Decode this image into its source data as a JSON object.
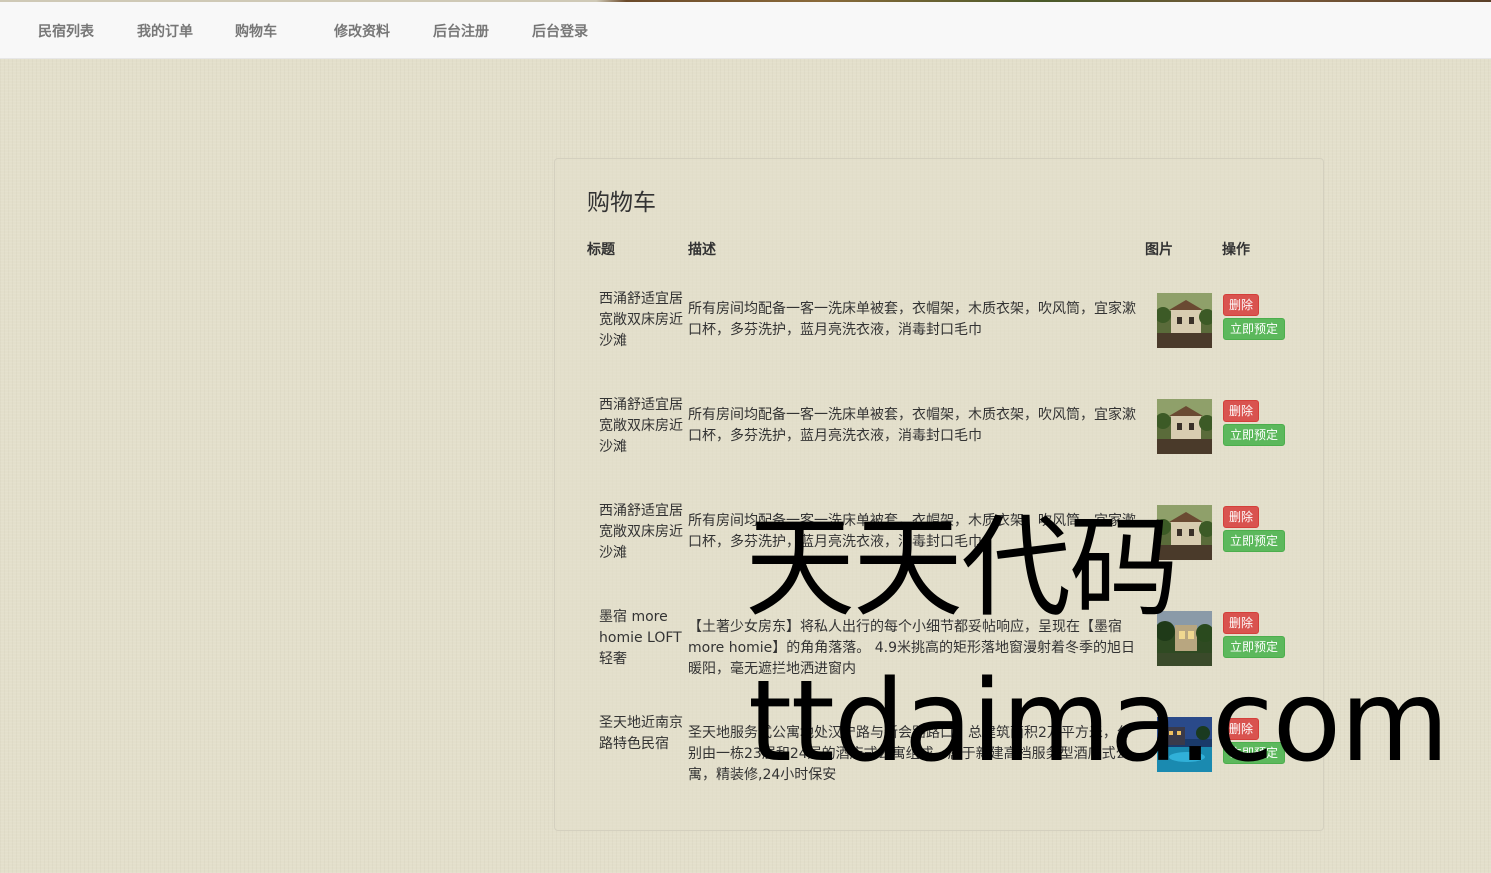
{
  "nav": {
    "items": [
      {
        "label": "民宿列表"
      },
      {
        "label": "我的订单"
      },
      {
        "label": "购物车"
      },
      {
        "label": "修改资料"
      },
      {
        "label": "后台注册"
      },
      {
        "label": "后台登录"
      }
    ]
  },
  "cart": {
    "title": "购物车",
    "columns": {
      "title": "标题",
      "desc": "描述",
      "image": "图片",
      "action": "操作"
    },
    "rows": [
      {
        "title": "西涌舒适宜居宽敞双床房近沙滩",
        "desc": "所有房间均配备一客一洗床单被套，衣帽架，木质衣架，吹风筒，宜家漱口杯，多芬洗护，蓝月亮洗衣液，消毒封口毛巾",
        "image_icon": "house-photo",
        "delete_label": "删除",
        "book_label": "立即预定"
      },
      {
        "title": "西涌舒适宜居宽敞双床房近沙滩",
        "desc": "所有房间均配备一客一洗床单被套，衣帽架，木质衣架，吹风筒，宜家漱口杯，多芬洗护，蓝月亮洗衣液，消毒封口毛巾",
        "image_icon": "house-photo",
        "delete_label": "删除",
        "book_label": "立即预定"
      },
      {
        "title": "西涌舒适宜居宽敞双床房近沙滩",
        "desc": "所有房间均配备一客一洗床单被套，衣帽架，木质衣架，吹风筒，宜家漱口杯，多芬洗护，蓝月亮洗衣液，消毒封口毛巾",
        "image_icon": "house-photo",
        "delete_label": "删除",
        "book_label": "立即预定"
      },
      {
        "title": "墨宿 more homie LOFT 轻奢",
        "desc": "【土著少女房东】将私人出行的每个小细节都妥帖响应，呈现在【墨宿 more homie】的角角落落。 4.9米挑高的矩形落地窗漫射着冬季的旭日暖阳，毫无遮拦地洒进窗内",
        "image_icon": "garden-photo",
        "delete_label": "删除",
        "book_label": "立即预定"
      },
      {
        "title": "圣天地近南京路特色民宿",
        "desc": "圣天地服务式公寓地处汉宁路与新会路路口。总建筑面积2万平方米，分别由一栋23层和24层的酒店式公寓组成，属于新建高档服务型酒店式公寓，精装修,24小时保安",
        "image_icon": "pool-night-photo",
        "delete_label": "删除",
        "book_label": "立即预定"
      }
    ]
  },
  "watermark": {
    "line1": "天天代码",
    "line2": "ttdaima.com"
  },
  "colors": {
    "danger": "#d9534f",
    "success": "#5cb85c",
    "background": "#e3dfcb",
    "navbar": "#f8f8f8"
  }
}
